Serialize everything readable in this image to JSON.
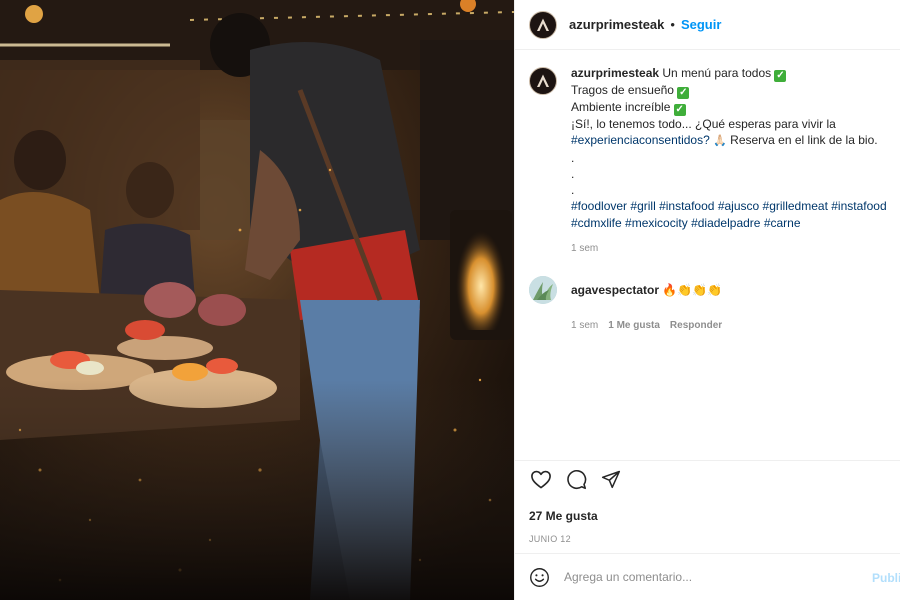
{
  "post": {
    "username": "azurprimesteak",
    "follow_label": "Seguir",
    "header_separator": "•",
    "caption": {
      "line1": "Un menú para todos",
      "line2": "Tragos de ensueño",
      "line3": "Ambiente increíble",
      "line4": "¡Sí!, lo tenemos todo... ¿Qué esperas para vivir la",
      "line5_tag": "#experienciaconsentidos?",
      "line5_text": "Reserva en el link de la bio.",
      "dots": ".",
      "hashtags_line1": [
        "#foodlover",
        "#grill",
        "#instafood",
        "#ajusco",
        "#grilledmeat",
        "#instafood"
      ],
      "hashtags_line2": [
        "#cdmxlife",
        "#mexicocity",
        "#diadelpadre",
        "#carne"
      ],
      "time": "1 sem"
    },
    "comment": {
      "username": "agavespectator",
      "emoji": "🔥👏👏👏",
      "time": "1 sem",
      "likes": "1 Me gusta",
      "reply": "Responder"
    },
    "likes_count": "27 Me gusta",
    "date": "JUNIO 12",
    "add_comment": {
      "placeholder": "Agrega un comentario...",
      "post_label": "Publicar"
    }
  },
  "icons": {
    "like": "heart-icon",
    "comment": "comment-icon",
    "share": "share-icon",
    "emoji": "emoji-icon"
  },
  "colors": {
    "accent": "#0095f6",
    "hashtag": "#00376b",
    "muted": "#8e8e8e",
    "post_disabled": "#b2dffc"
  }
}
